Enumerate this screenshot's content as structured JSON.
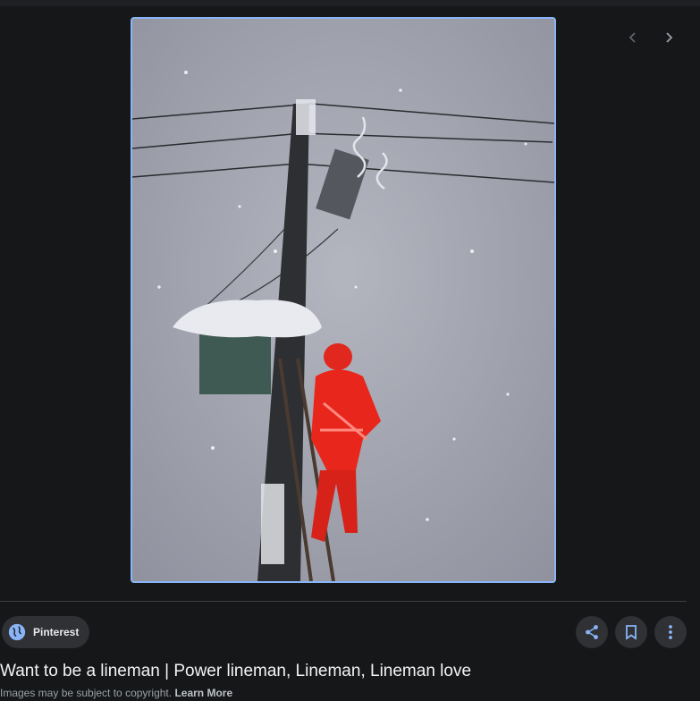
{
  "navigation": {
    "prev_icon": "chevron-left-icon",
    "next_icon": "chevron-right-icon"
  },
  "image": {
    "icon": "photo-lineman-on-snowy-pole"
  },
  "source": {
    "icon": "globe-icon",
    "label": "Pinterest"
  },
  "actions": {
    "share_icon": "share-icon",
    "save_icon": "bookmark-icon",
    "more_icon": "more-vert-icon"
  },
  "title": "Want to be a lineman | Power lineman, Lineman, Lineman love",
  "copyright": {
    "text": "Images may be subject to copyright.",
    "link": "Learn More"
  },
  "colors": {
    "background": "#161719",
    "accent": "#8ab4f8",
    "chip": "#303134"
  }
}
